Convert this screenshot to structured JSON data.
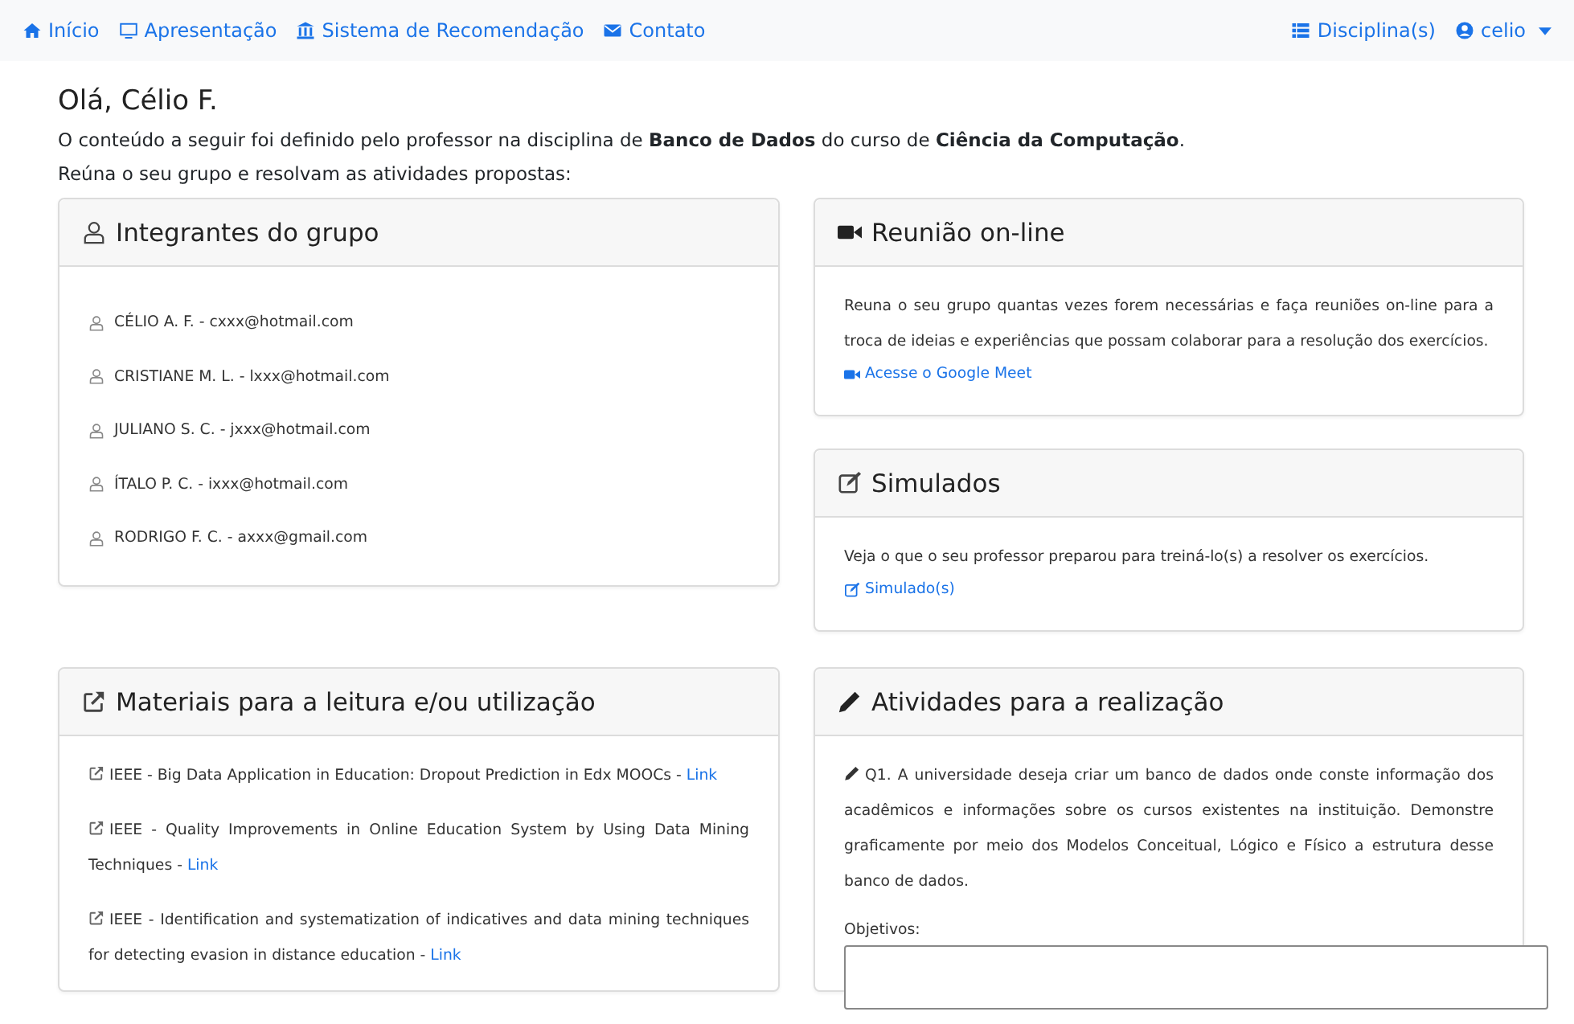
{
  "nav": {
    "left": [
      "Início",
      "Apresentação",
      "Sistema de Recomendação",
      "Contato"
    ],
    "right": [
      "Disciplina(s)",
      "celio"
    ]
  },
  "greeting": "Olá, Célio F.",
  "intro": [
    "O conteúdo a seguir foi definido pelo professor na disciplina de **Banco de Dados** do curso de **Ciência da Computação**.",
    "Reúna o seu grupo e resolvam as atividades propostas:"
  ],
  "members": {
    "title": "Integrantes do grupo",
    "items": [
      "CÉLIO A. F. - cxxx@hotmail.com",
      "CRISTIANE M. L. - lxxx@hotmail.com",
      "JULIANO S. C. - jxxx@hotmail.com",
      "ÍTALO P. C. - ixxx@hotmail.com",
      "RODRIGO F. C. - axxx@gmail.com"
    ]
  },
  "meeting": {
    "title": "Reunião on-line",
    "text": "Reuna o seu grupo quantas vezes forem necessárias e faça reuniões on-line para a troca de ideias e experiências que possam colaborar para a resolução dos exercícios.",
    "link": "Acesse o Google Meet"
  },
  "mock": {
    "title": "Simulados",
    "text": "Veja o que o seu professor preparou para treiná-lo(s) a resolver os exercícios.",
    "link": "Simulado(s)"
  },
  "materials": {
    "title": "Materiais para a leitura e/ou utilização",
    "items": [
      {
        "text": "IEEE - Big Data Application in Education: Dropout Prediction in Edx MOOCs -",
        "link": "Link"
      },
      {
        "text": "IEEE - Quality Improvements in Online Education System by Using Data Mining Techniques -",
        "link": "Link"
      },
      {
        "text": "IEEE - Identification and systematization of indicatives and data mining techniques for detecting evasion in distance education -",
        "link": "Link"
      }
    ]
  },
  "activities": {
    "title": "Atividades para a realização",
    "question": "Q1. A universidade deseja criar um banco de dados onde conste informação dos acadêmicos e informações sobre os cursos existentes na instituição. Demonstre graficamente por meio dos Modelos Conceitual, Lógico e Físico a estrutura desse banco de dados.",
    "field_label": "Objetivos:"
  }
}
